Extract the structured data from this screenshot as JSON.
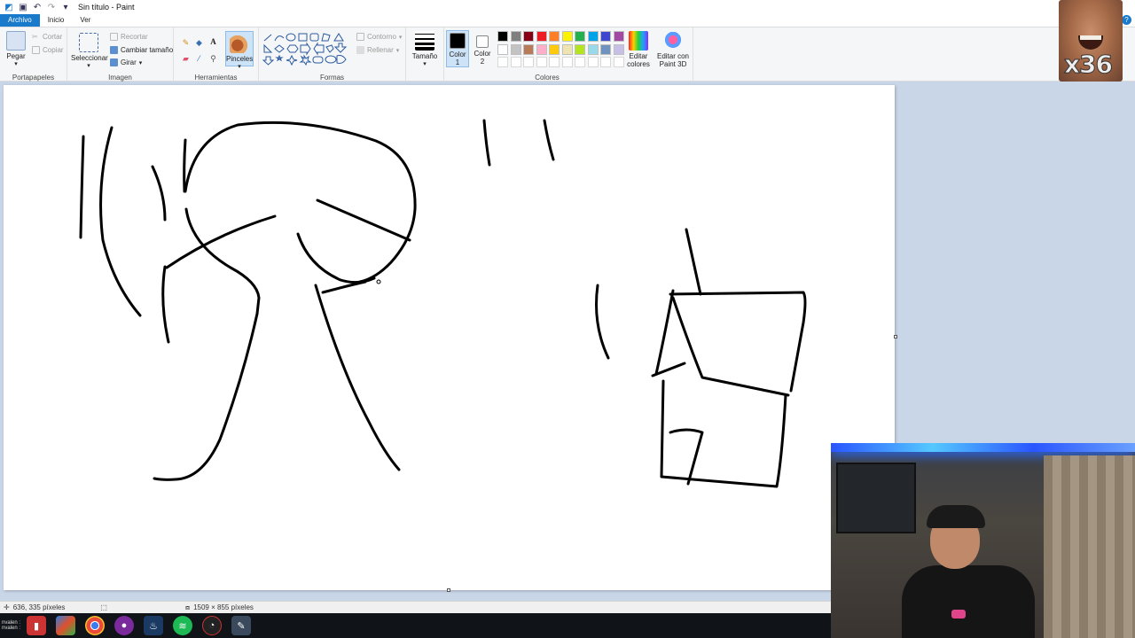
{
  "window": {
    "title": "Sin título - Paint"
  },
  "tabs": [
    {
      "label": "Archivo"
    },
    {
      "label": "Inicio"
    },
    {
      "label": "Ver"
    }
  ],
  "ribbon": {
    "clipboard": {
      "label": "Portapapeles",
      "paste": "Pegar",
      "cut": "Cortar",
      "copy": "Copiar"
    },
    "image": {
      "label": "Imagen",
      "select": "Seleccionar",
      "crop": "Recortar",
      "resize": "Cambiar tamaño",
      "rotate": "Girar"
    },
    "tools": {
      "label": "Herramientas",
      "brushes": "Pinceles"
    },
    "shapes": {
      "label": "Formas",
      "outline": "Contorno",
      "fill": "Rellenar"
    },
    "size": {
      "label": "Tamaño"
    },
    "colors": {
      "label": "Colores",
      "color1": "Color\n1",
      "color1_value": "#000000",
      "color2": "Color\n2",
      "color2_value": "#ffffff",
      "edit_colors": "Editar colores",
      "paint3d": "Editar con Paint 3D",
      "palette_row1": [
        "#000000",
        "#7f7f7f",
        "#880015",
        "#ed1c24",
        "#ff7f27",
        "#fff200",
        "#22b14c",
        "#00a2e8",
        "#3f48cc",
        "#a349a4"
      ],
      "palette_row2": [
        "#ffffff",
        "#c3c3c3",
        "#b97a57",
        "#ffaec9",
        "#ffc90e",
        "#efe4b0",
        "#b5e61d",
        "#99d9ea",
        "#7092be",
        "#c8bfe7"
      ]
    }
  },
  "status": {
    "cursor_position": "636, 335 píxeles",
    "canvas_size": "1509 × 855 píxeles"
  },
  "taskbar": {
    "user_label": "nvalen : nvalen :"
  },
  "overlay": {
    "emote_count": "x36"
  }
}
